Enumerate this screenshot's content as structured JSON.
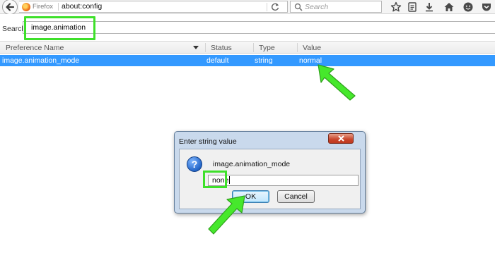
{
  "toolbar": {
    "identity_label": "Firefox",
    "url": "about:config",
    "search_placeholder": "Search"
  },
  "config": {
    "search_label": "Search:",
    "filter_value": "image.animation",
    "columns": {
      "name": "Preference Name",
      "status": "Status",
      "type": "Type",
      "value": "Value"
    },
    "rows": [
      {
        "name": "image.animation_mode",
        "status": "default",
        "type": "string",
        "value": "normal"
      }
    ]
  },
  "dialog": {
    "title": "Enter string value",
    "prompt": "image.animation_mode",
    "input_value": "none",
    "ok_label": "OK",
    "cancel_label": "Cancel"
  },
  "colors": {
    "highlight_green": "#3ee02a",
    "selection_blue": "#3399ff"
  },
  "icons": [
    "back-arrow-icon",
    "firefox-logo-icon",
    "reload-icon",
    "search-icon",
    "bookmark-star-icon",
    "reading-list-icon",
    "downloads-icon",
    "home-icon",
    "hello-icon",
    "pocket-icon",
    "question-icon",
    "close-icon"
  ]
}
